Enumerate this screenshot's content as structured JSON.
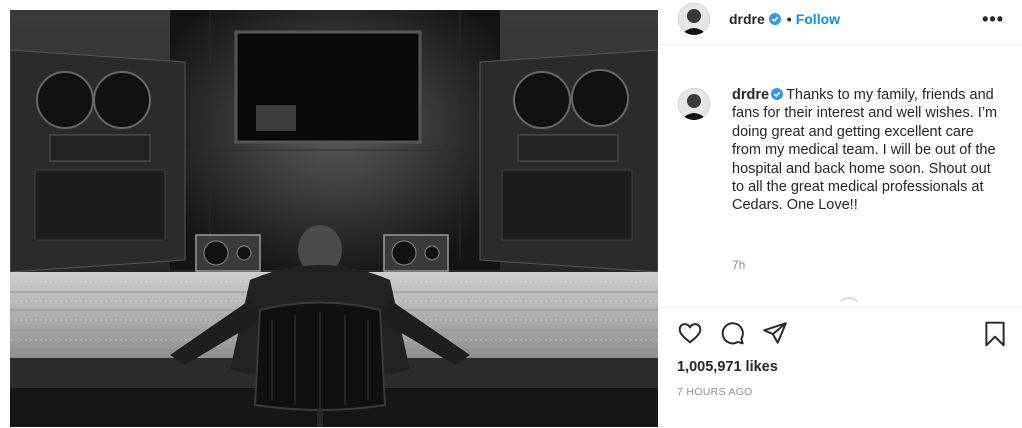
{
  "post": {
    "image_alt": "Photo by drdre"
  },
  "header": {
    "username": "drdre",
    "separator": "•",
    "follow_label": "Follow",
    "more_label": "•••",
    "verified": true
  },
  "caption": {
    "username": "drdre",
    "text": "Thanks to my family, friends and fans for their interest and well wishes. I’m doing great and getting excellent care from my medical team. I will be out of the hospital and back home soon. Shout out to all the great medical professionals at Cedars. One Love!!",
    "relative_time": "7h"
  },
  "engagement": {
    "likes": "1,005,971 likes",
    "posted_ago": "7 HOURS AGO"
  },
  "icons": {
    "like": "heart-icon",
    "comment": "comment-icon",
    "share": "share-icon",
    "save": "bookmark-icon"
  },
  "colors": {
    "follow": "#0095f6",
    "verified": "#3897f0",
    "text": "#262626",
    "muted": "#8e8e8e"
  }
}
